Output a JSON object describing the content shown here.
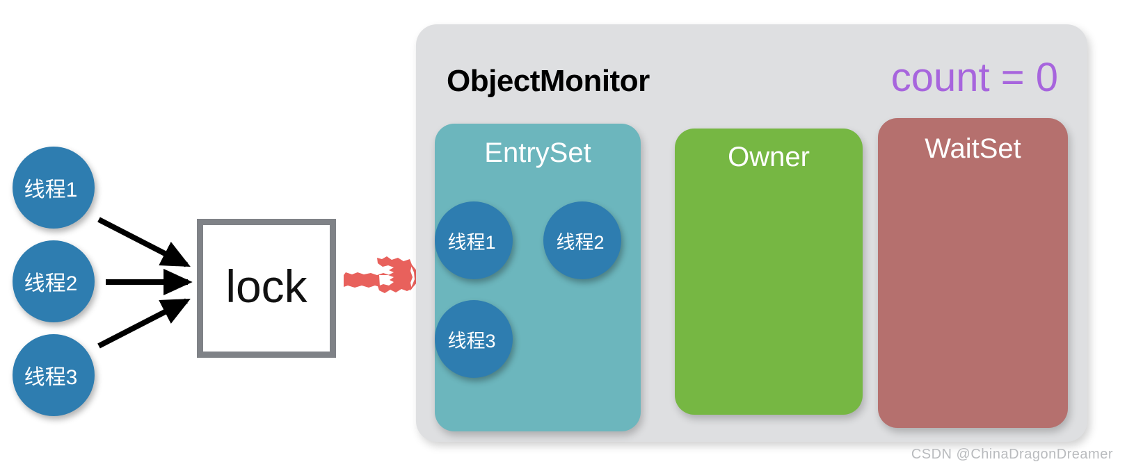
{
  "diagram": {
    "title": "ObjectMonitor",
    "count_label": "count = 0",
    "watermark": "CSDN @ChinaDragonDreamer"
  },
  "colors": {
    "thread_circle": "#2e7db0",
    "entryset_panel": "#6cb6bd",
    "owner_panel": "#76b743",
    "waitset_panel": "#b5706e",
    "monitor_background": "#dedfe1",
    "count_text": "#a765dd",
    "lock_border": "#7f8287",
    "red_arrow": "#e8615c",
    "black_arrow": "#000000",
    "watermark_text": "#b9bbbe"
  },
  "waiting_threads": [
    {
      "label": "线程1"
    },
    {
      "label": "线程2"
    },
    {
      "label": "线程3"
    }
  ],
  "lock": {
    "label": "lock"
  },
  "panels": {
    "entryset": {
      "title": "EntrySet",
      "threads": [
        {
          "label": "线程1"
        },
        {
          "label": "线程2"
        },
        {
          "label": "线程3"
        }
      ]
    },
    "owner": {
      "title": "Owner",
      "threads": []
    },
    "waitset": {
      "title": "WaitSet",
      "threads": []
    }
  }
}
